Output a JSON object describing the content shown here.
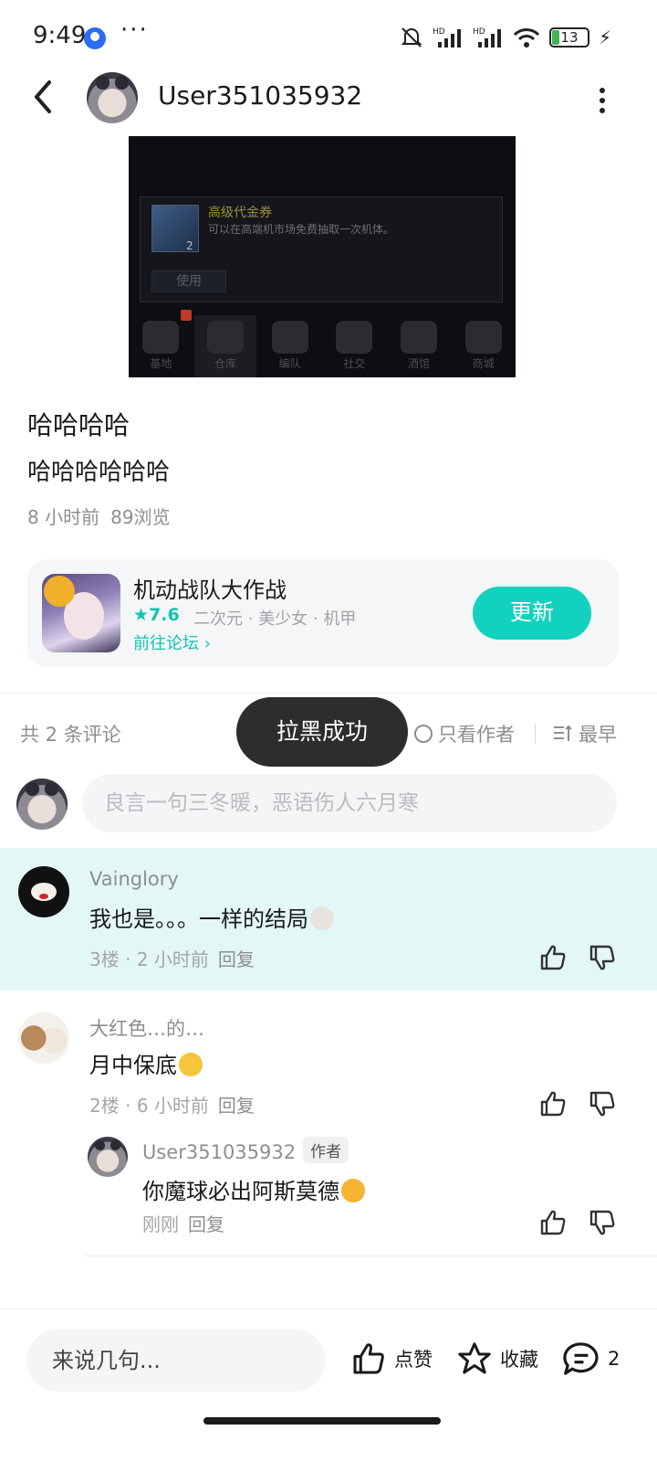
{
  "status_bar": {
    "time": "9:49",
    "more": "···",
    "battery": "13",
    "icons": [
      "app-badge-icon",
      "mute-bell-icon",
      "signal-hd-icon",
      "signal-hd-icon",
      "wifi-icon",
      "battery-icon",
      "charging-icon"
    ]
  },
  "header": {
    "username": "User351035932",
    "icons": [
      "back-icon",
      "more-vertical-icon"
    ]
  },
  "post": {
    "image": {
      "item_title": "高级代金券",
      "item_desc": "可以在高端机市场免费抽取一次机体。",
      "item_count": "2",
      "use_label": "使用",
      "nav": [
        "基地",
        "仓库",
        "编队",
        "社交",
        "酒馆",
        "商城"
      ]
    },
    "title": "哈哈哈哈",
    "body": "哈哈哈哈哈哈",
    "time_ago": "8 小时前",
    "views": "89浏览"
  },
  "game": {
    "name": "机动战队大作战",
    "rating": "7.6",
    "tags": "二次元 · 美少女 · 机甲",
    "forum_link": "前往论坛",
    "update_label": "更新",
    "accent": "#12d2bf"
  },
  "comments_header": {
    "count": "共 2 条评论",
    "author_only": "只看作者",
    "sort": "最早"
  },
  "toast": "拉黑成功",
  "comment_input": {
    "placeholder": "良言一句三冬暖，恶语伤人六月寒"
  },
  "comments": [
    {
      "user": "Vainglory",
      "text": "我也是。。。一样的结局",
      "floor": "3楼",
      "time": "2 小时前",
      "reply": "回复",
      "highlighted": true,
      "highlight_color": "#e2f7f6"
    },
    {
      "user": "大红色…的…",
      "text": "月中保底",
      "floor": "2楼",
      "time": "6 小时前",
      "reply": "回复",
      "replies": [
        {
          "user": "User351035932",
          "badge": "作者",
          "text": "你魔球必出阿斯莫德",
          "time": "刚刚",
          "reply": "回复"
        }
      ]
    }
  ],
  "bottom_bar": {
    "input_placeholder": "来说几句...",
    "like_label": "点赞",
    "fav_label": "收藏",
    "comment_count": "2"
  }
}
